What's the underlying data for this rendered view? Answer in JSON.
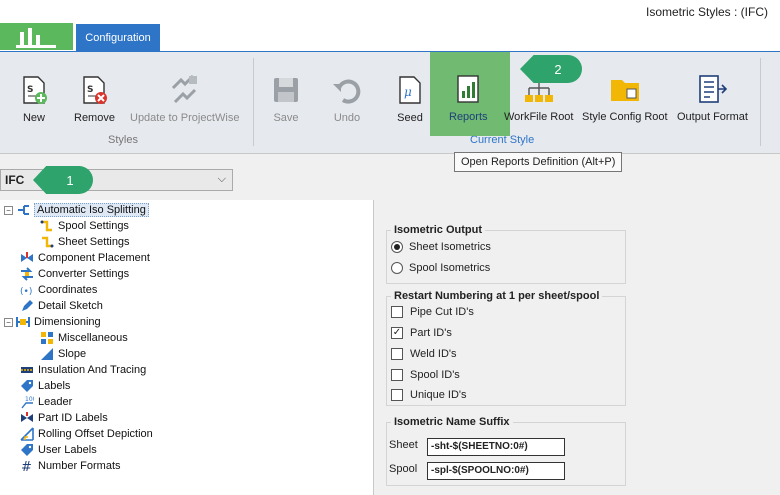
{
  "window": {
    "title": "Isometric Styles : (IFC)"
  },
  "tabs": {
    "configuration": "Configuration"
  },
  "ribbon": {
    "styles_group": {
      "label": "Styles",
      "new": "New",
      "remove": "Remove",
      "update": "Update to ProjectWise"
    },
    "current_style_group": {
      "label": "Current Style",
      "save": "Save",
      "undo": "Undo",
      "seed": "Seed",
      "reports": "Reports",
      "workfile_root": "WorkFile Root",
      "style_config_root": "Style Config Root",
      "output_format": "Output Format"
    }
  },
  "tooltip": {
    "text": "Open Reports Definition (Alt+P)"
  },
  "callouts": {
    "one": "1",
    "two": "2"
  },
  "style_selector": {
    "value": "IFC"
  },
  "tree": {
    "items": [
      {
        "label": "Automatic Iso Splitting"
      },
      {
        "label": "Spool Settings"
      },
      {
        "label": "Sheet Settings"
      },
      {
        "label": "Component Placement"
      },
      {
        "label": "Converter Settings"
      },
      {
        "label": "Coordinates"
      },
      {
        "label": "Detail Sketch"
      },
      {
        "label": "Dimensioning"
      },
      {
        "label": "Miscellaneous"
      },
      {
        "label": "Slope"
      },
      {
        "label": "Insulation And Tracing"
      },
      {
        "label": "Labels"
      },
      {
        "label": "Leader"
      },
      {
        "label": "Part ID Labels"
      },
      {
        "label": "Rolling Offset Depiction"
      },
      {
        "label": "User Labels"
      },
      {
        "label": "Number Formats"
      }
    ]
  },
  "isometric_output": {
    "title": "Isometric Output",
    "sheet": "Sheet Isometrics",
    "spool": "Spool Isometrics",
    "selected": "Sheet Isometrics"
  },
  "restart_numbering": {
    "title": "Restart Numbering at 1 per sheet/spool",
    "items": [
      {
        "label": "Pipe Cut ID's",
        "checked": false
      },
      {
        "label": "Part ID's",
        "checked": true
      },
      {
        "label": "Weld ID's",
        "checked": false
      },
      {
        "label": "Spool ID's",
        "checked": false
      },
      {
        "label": "Unique ID's",
        "checked": false
      }
    ]
  },
  "name_suffix": {
    "title": "Isometric Name Suffix",
    "sheet_label": "Sheet",
    "sheet_value": "-sht-$(SHEETNO:0#)",
    "spool_label": "Spool",
    "spool_value": "-spl-$(SPOOLNO:0#)"
  },
  "colors": {
    "accent_blue": "#2e75c8",
    "app_green": "#5cb85c",
    "callout_green": "#2ea36b"
  }
}
